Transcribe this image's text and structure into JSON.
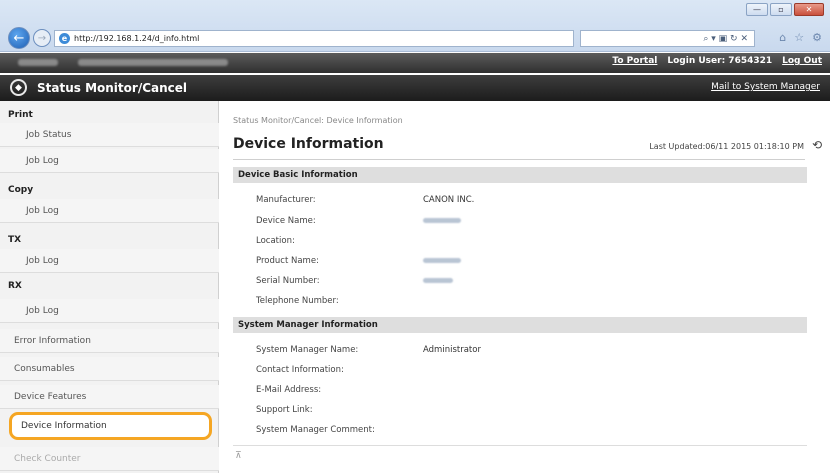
{
  "browser": {
    "url": "http://192.168.1.24/d_info.html",
    "address_tools": "⌕ ▾ ▣ ↻ ✕",
    "win_buttons": [
      "—",
      "▫",
      "✕"
    ]
  },
  "topbar": {
    "to_portal": "To Portal",
    "login_user": "Login User:  7654321",
    "log_out": "Log Out"
  },
  "titlebar": {
    "title": "Status Monitor/Cancel",
    "mail_link": "Mail to System Manager"
  },
  "sidebar": {
    "print": "Print",
    "job_status": "Job Status",
    "print_job_log": "Job Log",
    "copy": "Copy",
    "copy_job_log": "Job Log",
    "tx": "TX",
    "tx_job_log": "Job Log",
    "rx": "RX",
    "rx_job_log": "Job Log",
    "error_information": "Error Information",
    "consumables": "Consumables",
    "device_features": "Device Features",
    "device_information": "Device Information",
    "check_counter": "Check Counter"
  },
  "main": {
    "breadcrumb": "Status Monitor/Cancel: Device Information",
    "title": "Device Information",
    "last_updated": "Last Updated:06/11 2015 01:18:10 PM",
    "basic": {
      "heading": "Device Basic Information",
      "manufacturer_label": "Manufacturer:",
      "manufacturer_value": "CANON INC.",
      "device_name_label": "Device Name:",
      "location_label": "Location:",
      "product_name_label": "Product Name:",
      "serial_label": "Serial Number:",
      "telephone_label": "Telephone Number:"
    },
    "manager": {
      "heading": "System Manager Information",
      "name_label": "System Manager Name:",
      "name_value": "Administrator",
      "contact_label": "Contact Information:",
      "email_label": "E-Mail Address:",
      "support_label": "Support Link:",
      "comment_label": "System Manager Comment:"
    }
  }
}
